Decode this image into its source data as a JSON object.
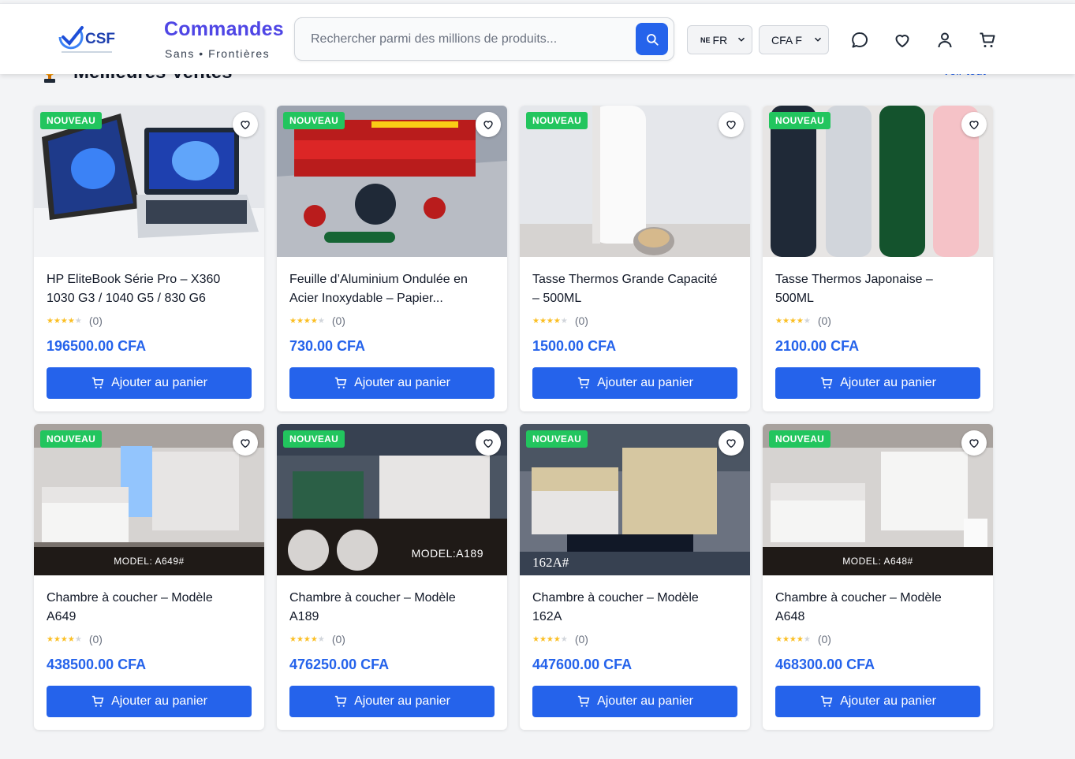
{
  "header": {
    "brand_title": "Commandes",
    "brand_subtitle": "Sans • Frontières",
    "logo_text": "CSF",
    "search_placeholder": "Rechercher parmi des millions de produits...",
    "language": {
      "flag": "NE",
      "value": "FR"
    },
    "currency": {
      "value": "CFA F"
    },
    "icons": [
      "chat-icon",
      "heart-icon",
      "user-icon",
      "cart-icon"
    ]
  },
  "section": {
    "title": "Meilleures Ventes",
    "see_all": "Voir tout"
  },
  "products": [
    {
      "badge": "NOUVEAU",
      "title": "HP EliteBook Série Pro – X360 1030 G3 / 1040 G5 / 830 G6",
      "title_lines": [
        "HP EliteBook Série Pro – X360",
        "1030 G3 / 1040 G5 / 830 G6"
      ],
      "reviews": "(0)",
      "rating": 4,
      "price": "196500.00 CFA",
      "button": "Ajouter au panier",
      "caption": ""
    },
    {
      "badge": "NOUVEAU",
      "title": "Feuille d'Aluminium Ondulée en Acier Inoxydable – Papier...",
      "title_lines": [
        "Feuille d’Aluminium Ondulée en",
        "Acier Inoxydable – Papier..."
      ],
      "reviews": "(0)",
      "rating": 4,
      "price": "730.00 CFA",
      "button": "Ajouter au panier",
      "caption": ""
    },
    {
      "badge": "NOUVEAU",
      "title": "Tasse Thermos Grande Capacité – 500ML",
      "title_lines": [
        "Tasse Thermos Grande Capacité",
        "– 500ML"
      ],
      "reviews": "(0)",
      "rating": 4,
      "price": "1500.00 CFA",
      "button": "Ajouter au panier",
      "caption": ""
    },
    {
      "badge": "NOUVEAU",
      "title": "Tasse Thermos Japonaise – 500ML",
      "title_lines": [
        "Tasse Thermos Japonaise –",
        "500ML"
      ],
      "reviews": "(0)",
      "rating": 4,
      "price": "2100.00 CFA",
      "button": "Ajouter au panier",
      "caption": ""
    },
    {
      "badge": "NOUVEAU",
      "title": "Chambre à coucher – Modèle A649",
      "title_lines": [
        "Chambre à coucher – Modèle",
        "A649"
      ],
      "reviews": "(0)",
      "rating": 4,
      "price": "438500.00 CFA",
      "button": "Ajouter au panier",
      "caption": "MODEL:  A649#"
    },
    {
      "badge": "NOUVEAU",
      "title": "Chambre à coucher – Modèle A189",
      "title_lines": [
        "Chambre à coucher – Modèle",
        "A189"
      ],
      "reviews": "(0)",
      "rating": 4,
      "price": "476250.00 CFA",
      "button": "Ajouter au panier",
      "caption": "MODEL:A189"
    },
    {
      "badge": "NOUVEAU",
      "title": "Chambre à coucher – Modèle 162A",
      "title_lines": [
        "Chambre à coucher – Modèle",
        "162A"
      ],
      "reviews": "(0)",
      "rating": 4,
      "price": "447600.00 CFA",
      "button": "Ajouter au panier",
      "caption": "162A#"
    },
    {
      "badge": "NOUVEAU",
      "title": "Chambre à coucher – Modèle A648",
      "title_lines": [
        "Chambre à coucher – Modèle",
        "A648"
      ],
      "reviews": "(0)",
      "rating": 4,
      "price": "468300.00 CFA",
      "button": "Ajouter au panier",
      "caption": "MODEL:  A648#"
    }
  ],
  "colors": {
    "accent": "#2563eb",
    "brand": "#4f46e5",
    "badge": "#22c55e",
    "star": "#fbbf24"
  }
}
